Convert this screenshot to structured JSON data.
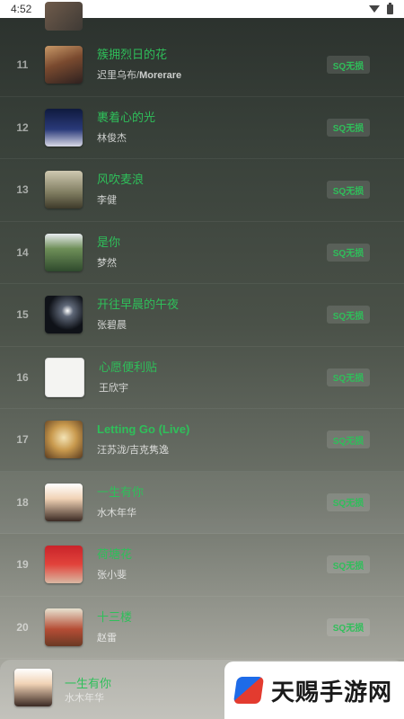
{
  "status_bar": {
    "time": "4:52"
  },
  "songs": [
    {
      "index": "11",
      "title": "簇拥烈日的花",
      "artist_main": "迟里乌布/",
      "artist_bold": "Morerare",
      "quality": "SQ无损"
    },
    {
      "index": "12",
      "title": "裹着心的光",
      "artist_main": "林俊杰",
      "artist_bold": "",
      "quality": "SQ无损"
    },
    {
      "index": "13",
      "title": "风吹麦浪",
      "artist_main": "李健",
      "artist_bold": "",
      "quality": "SQ无损"
    },
    {
      "index": "14",
      "title": "是你",
      "artist_main": "梦然",
      "artist_bold": "",
      "quality": "SQ无损"
    },
    {
      "index": "15",
      "title": "开往早晨的午夜",
      "artist_main": "张碧晨",
      "artist_bold": "",
      "quality": "SQ无损"
    },
    {
      "index": "16",
      "title": "心愿便利贴",
      "artist_main": "王欣宇",
      "artist_bold": "",
      "quality": "SQ无损"
    },
    {
      "index": "17",
      "title": "Letting Go (Live)",
      "artist_main": "汪苏泷/吉克隽逸",
      "artist_bold": "",
      "quality": "SQ无损"
    },
    {
      "index": "18",
      "title": "一生有你",
      "artist_main": "水木年华",
      "artist_bold": "",
      "quality": "SQ无损"
    },
    {
      "index": "19",
      "title": "荷塘花",
      "artist_main": "张小斐",
      "artist_bold": "",
      "quality": "SQ无损"
    },
    {
      "index": "20",
      "title": "十三楼",
      "artist_main": "赵雷",
      "artist_bold": "",
      "quality": "SQ无损"
    }
  ],
  "now_playing": {
    "title": "一生有你",
    "artist": "水木年华"
  },
  "watermark": {
    "text": "天赐手游网"
  }
}
